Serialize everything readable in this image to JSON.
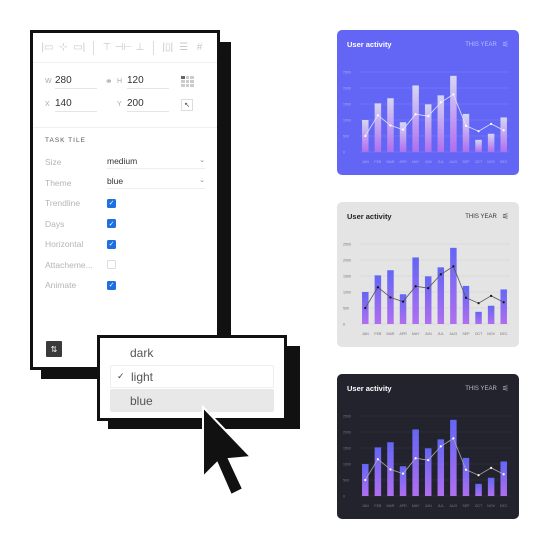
{
  "panel": {
    "align_icons": [
      "align-left-icon",
      "align-center-h-icon",
      "align-right-icon",
      "align-top-icon",
      "align-center-v-icon",
      "align-bottom-icon",
      "distribute-h-icon",
      "distribute-v-icon",
      "grid-icon"
    ],
    "width_label": "W",
    "width_value": "280",
    "height_label": "H",
    "height_value": "120",
    "x_label": "X",
    "x_value": "140",
    "y_label": "Y",
    "y_value": "200",
    "section_title": "TASK TILE",
    "props": {
      "size": {
        "label": "Size",
        "value": "medium"
      },
      "theme": {
        "label": "Theme",
        "value": "blue"
      },
      "trendline": {
        "label": "Trendline",
        "checked": true
      },
      "days": {
        "label": "Days",
        "checked": true
      },
      "horizontal": {
        "label": "Horizontal",
        "checked": true
      },
      "attachements": {
        "label": "Attacheme...",
        "checked": false
      },
      "animate": {
        "label": "Animate",
        "checked": true
      }
    }
  },
  "dropdown": {
    "options": [
      {
        "label": "dark",
        "selected": false,
        "hovered": false
      },
      {
        "label": "light",
        "selected": true,
        "hovered": false
      },
      {
        "label": "blue",
        "selected": false,
        "hovered": true
      }
    ],
    "check_glyph": "✓"
  },
  "cards": [
    {
      "theme": "blue",
      "title": "User activity",
      "period": "THIS YEAR",
      "bg": "#6366f5",
      "title_color": "#ffffff",
      "period_color": "#b8bcff",
      "grid_color": "#7d80f7",
      "tick_color": "#a6a9fb",
      "bar_top": "#d6d6f2",
      "bar_bottom": "#b06ef0",
      "line_color": "#e0e2ff",
      "dot_color": "#ffffff"
    },
    {
      "theme": "light",
      "title": "User activity",
      "period": "THIS YEAR",
      "bg": "#e4e4e4",
      "title_color": "#222222",
      "period_color": "#333333",
      "grid_color": "#cfcfcf",
      "tick_color": "#777777",
      "bar_top": "#6366f5",
      "bar_bottom": "#b06ef0",
      "line_color": "#555555",
      "dot_color": "#111111"
    },
    {
      "theme": "dark",
      "title": "User activity",
      "period": "THIS YEAR",
      "bg": "#23232e",
      "title_color": "#ffffff",
      "period_color": "#bbbbbb",
      "grid_color": "#3a3a48",
      "tick_color": "#777788",
      "bar_top": "#6366f5",
      "bar_bottom": "#b06ef0",
      "line_color": "#aaaaaa",
      "dot_color": "#ffffff"
    }
  ],
  "chart_data": {
    "type": "bar",
    "title": "User activity",
    "subtitle": "THIS YEAR",
    "categories": [
      "JAN",
      "FEB",
      "MAR",
      "APR",
      "MAY",
      "JUN",
      "JUL",
      "AUG",
      "SEP",
      "OCT",
      "NOV",
      "DEC"
    ],
    "series": [
      {
        "name": "bars",
        "type": "bar",
        "values": [
          1000,
          1520,
          1680,
          930,
          2080,
          1490,
          1770,
          2380,
          1190,
          380,
          570,
          1080
        ]
      },
      {
        "name": "trendline",
        "type": "line",
        "values": [
          500,
          1150,
          830,
          700,
          1180,
          1120,
          1550,
          1800,
          820,
          650,
          880,
          680
        ]
      }
    ],
    "yticks": [
      0,
      500,
      1000,
      1500,
      2000,
      2500
    ],
    "ylim": [
      0,
      2500
    ],
    "grid": true
  }
}
